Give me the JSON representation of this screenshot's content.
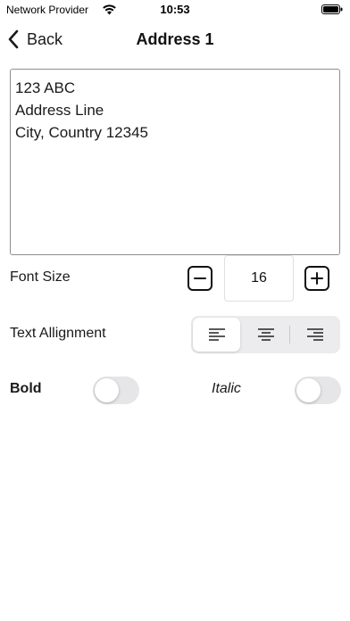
{
  "status_bar": {
    "carrier": "Network Provider",
    "time": "10:53",
    "wifi_icon": "wifi-icon",
    "battery_icon": "battery-icon"
  },
  "nav": {
    "back_label": "Back",
    "title": "Address 1"
  },
  "address_text": {
    "lines": [
      "123 ABC",
      "Address Line",
      "City, Country 12345"
    ]
  },
  "font_size": {
    "label": "Font Size",
    "value": "16",
    "decrement_icon": "minus-icon",
    "increment_icon": "plus-icon"
  },
  "text_alignment": {
    "label": "Text Allignment",
    "options": [
      "align-left-icon",
      "align-center-icon",
      "align-right-icon"
    ],
    "selected": "align-left-icon"
  },
  "bold": {
    "label": "Bold",
    "on": false
  },
  "italic": {
    "label": "Italic",
    "on": false
  },
  "colors": {
    "text": "#111111",
    "border": "#8e8e8e",
    "segment_bg": "#ececee",
    "toggle_off": "#e6e6e9"
  }
}
